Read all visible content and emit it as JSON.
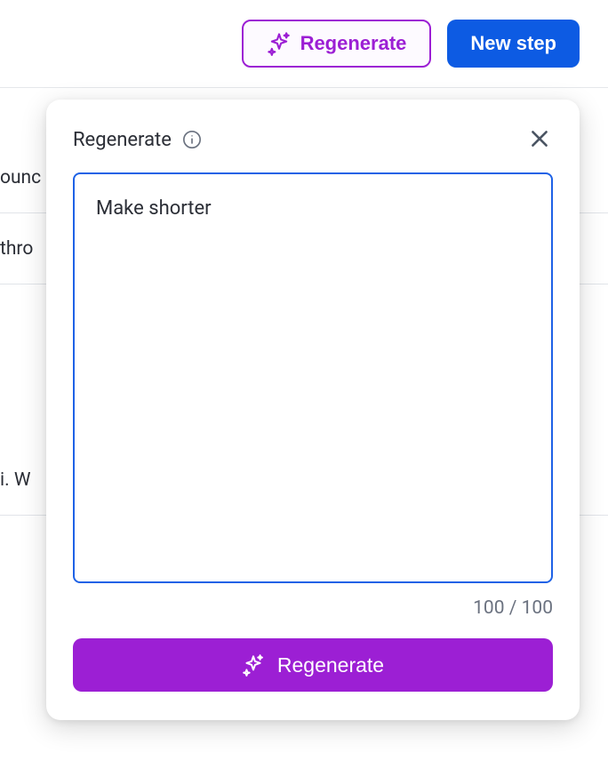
{
  "topBar": {
    "regenerate_label": "Regenerate",
    "new_step_label": "New step"
  },
  "background_lines": [
    "ounc",
    "thro",
    "",
    "i. W"
  ],
  "modal": {
    "title": "Regenerate",
    "input_value": "Make shorter",
    "counter": "100 / 100",
    "submit_label": "Regenerate"
  }
}
